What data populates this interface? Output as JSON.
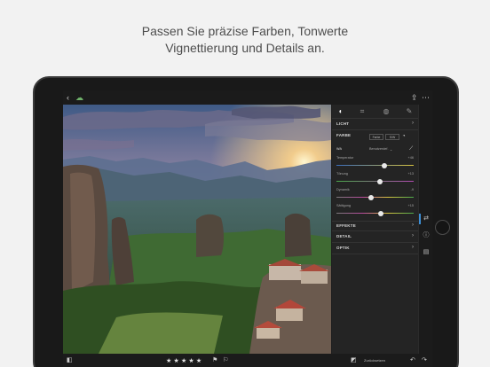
{
  "headline": {
    "line1": "Passen Sie präzise Farben, Tonwerte",
    "line2": "Vignettierung und Details an."
  },
  "topbar": {
    "back_icon": "chevron-left-icon",
    "cloud_icon": "cloud-sync-icon",
    "share_icon": "share-icon",
    "more_icon": "more-icon"
  },
  "panel": {
    "tabs": [
      "edit-icon",
      "crop-icon",
      "filters-icon",
      "healing-icon"
    ],
    "sections": {
      "licht": "LICHT",
      "farbe": "FARBE",
      "effekte": "EFFEKTE",
      "detail": "DETAIL",
      "optik": "OPTIK"
    },
    "farbe_modes": [
      "Farbe",
      "S/W"
    ],
    "wb_label": "WA",
    "wb_value": "Benutzerdef.",
    "sliders": [
      {
        "name": "Temperatur",
        "value": "+46",
        "position": 0.62
      },
      {
        "name": "Tönung",
        "value": "+13",
        "position": 0.56
      },
      {
        "name": "Dynamik",
        "value": "-9",
        "position": 0.45
      },
      {
        "name": "Sättigung",
        "value": "+15",
        "position": 0.57
      }
    ]
  },
  "bottombar": {
    "stars": "★★★★★",
    "reset": "Zurücksetzen"
  },
  "colors": {
    "accent": "#3d8fd6",
    "panel_bg": "#242424",
    "temperature_cool": "#3b6fbf",
    "temperature_warm": "#d8c441",
    "tint_green": "#4aa84a",
    "tint_magenta": "#b14ab1"
  }
}
